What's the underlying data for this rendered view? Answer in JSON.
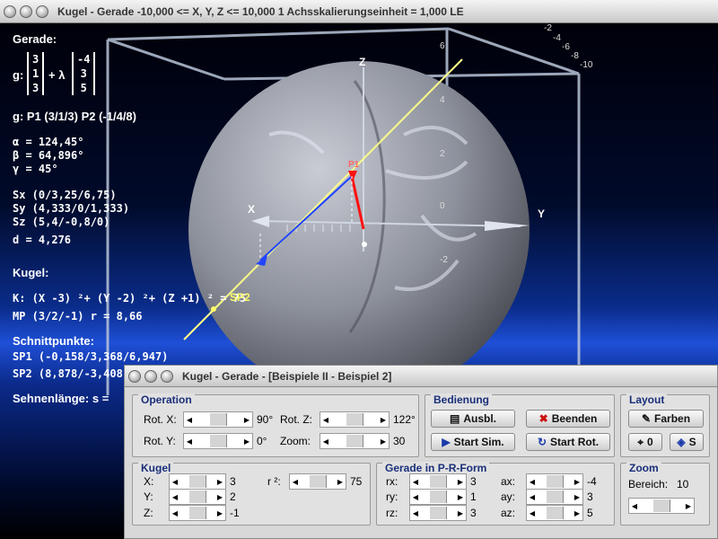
{
  "window": {
    "title": "Kugel - Gerade   -10,000 <= X, Y, Z <= 10,000    1 Achsskalierungseinheit = 1,000 LE"
  },
  "scene": {
    "axes": {
      "x": "X",
      "y": "Y",
      "z": "Z"
    },
    "z_scale": [
      "6",
      "4",
      "2",
      "0",
      "-2"
    ],
    "x_scale": [
      "-2",
      "-4",
      "-6",
      "-8",
      "-10"
    ],
    "point_label": "P1",
    "sp2_label": "SP2"
  },
  "info": {
    "gerade_heading": "Gerade:",
    "g_label": "g:",
    "vector1": [
      "3",
      "1",
      "3"
    ],
    "plus_lambda": "+ λ",
    "vector2": [
      "-4",
      "3",
      "5"
    ],
    "points": "g: P1 (3/1/3)    P2 (-1/4/8)",
    "alpha": "α = 124,45°",
    "beta": "β = 64,896°",
    "gamma": "γ = 45°",
    "sx": "Sx (0/3,25/6,75)",
    "sy": "Sy (4,333/0/1,333)",
    "sz": "Sz (5,4/-0,8/0)",
    "d": "d = 4,276",
    "kugel_heading": "Kugel:",
    "kugel_eq": "K: (X -3) ²+ (Y -2) ²+ (Z +1) ² = 75",
    "mp": "MP (3/2/-1)   r = 8,66",
    "schnitt_heading": "Schnittpunkte:",
    "sp1": "SP1 (-0,158/3,368/6,947)",
    "sp2": "SP2 (8,878/-3,408",
    "sehne": "Sehnenlänge: s ="
  },
  "control": {
    "title": "Kugel - Gerade - [Beispiele II - Beispiel 2]",
    "operation": {
      "label": "Operation",
      "rot_x_label": "Rot. X:",
      "rot_x_value": "90°",
      "rot_y_label": "Rot. Y:",
      "rot_y_value": "0°",
      "rot_z_label": "Rot. Z:",
      "rot_z_value": "122°",
      "zoom_label": "Zoom:",
      "zoom_value": "30"
    },
    "bedienung": {
      "label": "Bedienung",
      "ausbl": "Ausbl.",
      "beenden": "Beenden",
      "start_sim": "Start Sim.",
      "start_rot": "Start Rot."
    },
    "layout": {
      "label": "Layout",
      "farben": "Farben",
      "zero": "0",
      "s": "S"
    },
    "kugel": {
      "label": "Kugel",
      "x_label": "X:",
      "x_value": "3",
      "y_label": "Y:",
      "y_value": "2",
      "z_label": "Z:",
      "z_value": "-1",
      "r2_label": "r ²:",
      "r2_value": "75"
    },
    "gerade": {
      "label": "Gerade in P-R-Form",
      "rx_label": "rx:",
      "rx_value": "3",
      "ry_label": "ry:",
      "ry_value": "1",
      "rz_label": "rz:",
      "rz_value": "3",
      "ax_label": "ax:",
      "ax_value": "-4",
      "ay_label": "ay:",
      "ay_value": "3",
      "az_label": "az:",
      "az_value": "5"
    },
    "zoom": {
      "label": "Zoom",
      "bereich_label": "Bereich:",
      "bereich_value": "10"
    }
  },
  "colors": {
    "text": "#ffffff",
    "group_label": "#1a2f7a",
    "line": "#ffff88",
    "direction": "#2244ff",
    "point": "#ff1111"
  }
}
